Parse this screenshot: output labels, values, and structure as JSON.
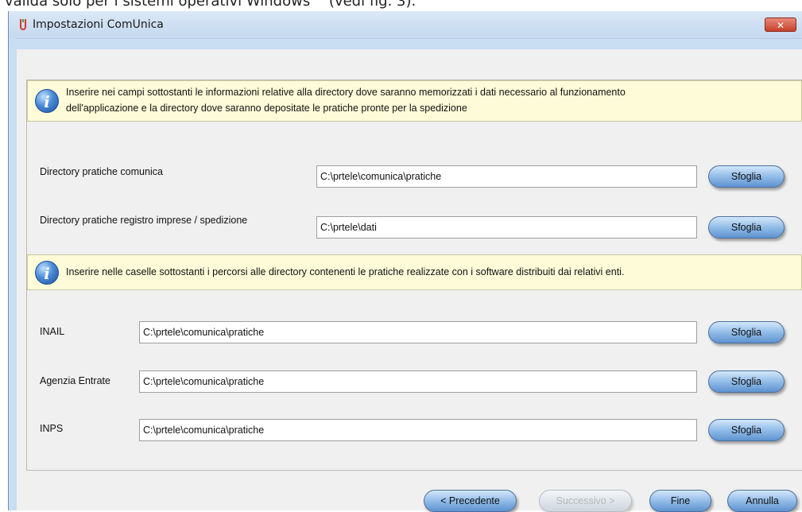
{
  "caption": "valida solo per i sistemi operativi Windows™ (vedi fig. 3).",
  "window": {
    "title": "Impostazioni ComUnica",
    "close_label": "✕"
  },
  "info1": {
    "icon": "info-icon",
    "line1": "Inserire nei campi sottostanti le informazioni relative alla directory dove saranno memorizzati i dati necessario al funzionamento",
    "line2": "dell'applicazione e la directory dove saranno depositate le pratiche pronte per la spedizione"
  },
  "fields": {
    "pratiche_comunica": {
      "label": "Directory pratiche comunica",
      "value": "C:\\prtele\\comunica\\pratiche",
      "button": "Sfoglia"
    },
    "registro_imprese": {
      "label": "Directory pratiche registro imprese / spedizione",
      "value": "C:\\prtele\\dati",
      "button": "Sfoglia"
    }
  },
  "info2": {
    "icon": "info-icon",
    "text": "Inserire nelle caselle sottostanti i percorsi alle directory contenenti le pratiche realizzate con i software distribuiti dai relativi enti."
  },
  "enti": [
    {
      "label": "INAIL",
      "value": "C:\\prtele\\comunica\\pratiche",
      "button": "Sfoglia"
    },
    {
      "label": "Agenzia Entrate",
      "value": "C:\\prtele\\comunica\\pratiche",
      "button": "Sfoglia"
    },
    {
      "label": "INPS",
      "value": "C:\\prtele\\comunica\\pratiche",
      "button": "Sfoglia"
    }
  ],
  "footer": {
    "previous": "< Precedente",
    "next": "Successivo >",
    "finish": "Fine",
    "cancel": "Annulla"
  },
  "colors": {
    "title_bar": "#c9ddf3",
    "info_background": "#fefbd8",
    "button_blue": "#98c0ea",
    "close_red": "#c6402b"
  }
}
